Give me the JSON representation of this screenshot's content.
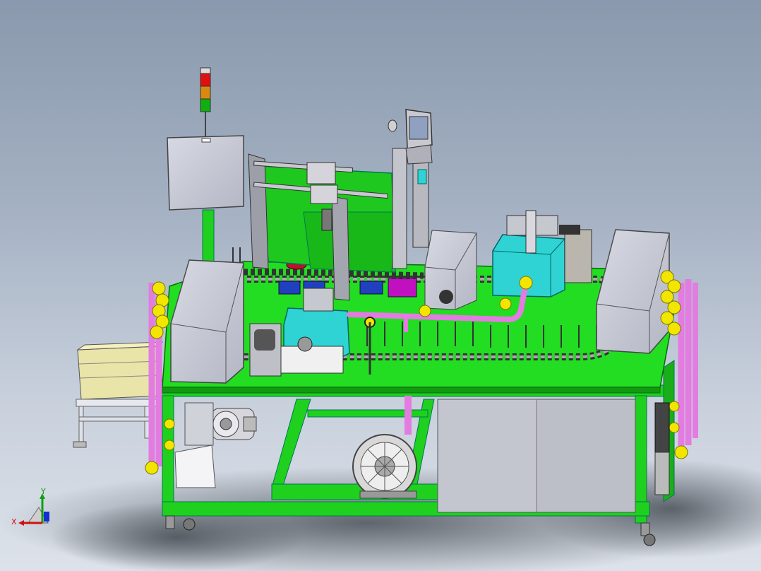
{
  "triad": {
    "x_label": "X",
    "y_label": "Y",
    "x_color": "#d01010",
    "y_color": "#10a010",
    "z_color": "#1030d0"
  },
  "colors": {
    "frame_green": "#1fd01f",
    "frame_green_dark": "#0f8a0f",
    "deck_green": "#22dd22",
    "enclosure_grey": "#c9cbd6",
    "cyan_station": "#2fd3d3",
    "pipe_pink": "#e27ce0",
    "elbow_yellow": "#f2e600",
    "signal_red": "#e01010",
    "signal_amber": "#d88a10",
    "signal_green": "#10b010"
  }
}
